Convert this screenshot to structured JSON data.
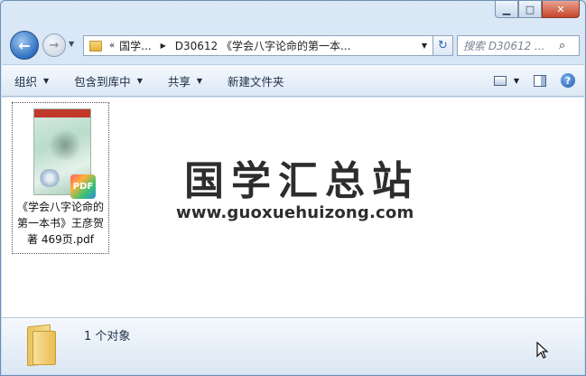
{
  "window": {
    "minimize_glyph": "▁",
    "maximize_glyph": "□",
    "close_glyph": "✕"
  },
  "nav": {
    "back_glyph": "←",
    "forward_glyph": "→",
    "history_glyph": "▼",
    "address_prefix": "«",
    "breadcrumbs": [
      "国学...",
      "D30612 《学会八字论命的第一本..."
    ],
    "breadcrumb_arrow": "▶",
    "dropdown_glyph": "▼",
    "refresh_glyph": "↻",
    "search_placeholder": "搜索 D30612 ...",
    "search_icon": "search-icon"
  },
  "toolbar": {
    "organize": "组织",
    "include_in_library": "包含到库中",
    "share": "共享",
    "new_folder": "新建文件夹",
    "dropdown_glyph": "▼",
    "help_glyph": "?"
  },
  "content": {
    "file": {
      "name_lines": [
        "《学会八字论命的",
        "第一本书》王彦贺",
        "著 469页.pdf"
      ],
      "badge": "PDF"
    },
    "watermark_title": "国学汇总站",
    "watermark_url": "www.guoxuehuizong.com"
  },
  "details": {
    "count_text": "1 个对象"
  },
  "colors": {
    "accent": "#2e6fc1",
    "close_red": "#c9452b",
    "folder_yellow": "#e8bd52"
  }
}
